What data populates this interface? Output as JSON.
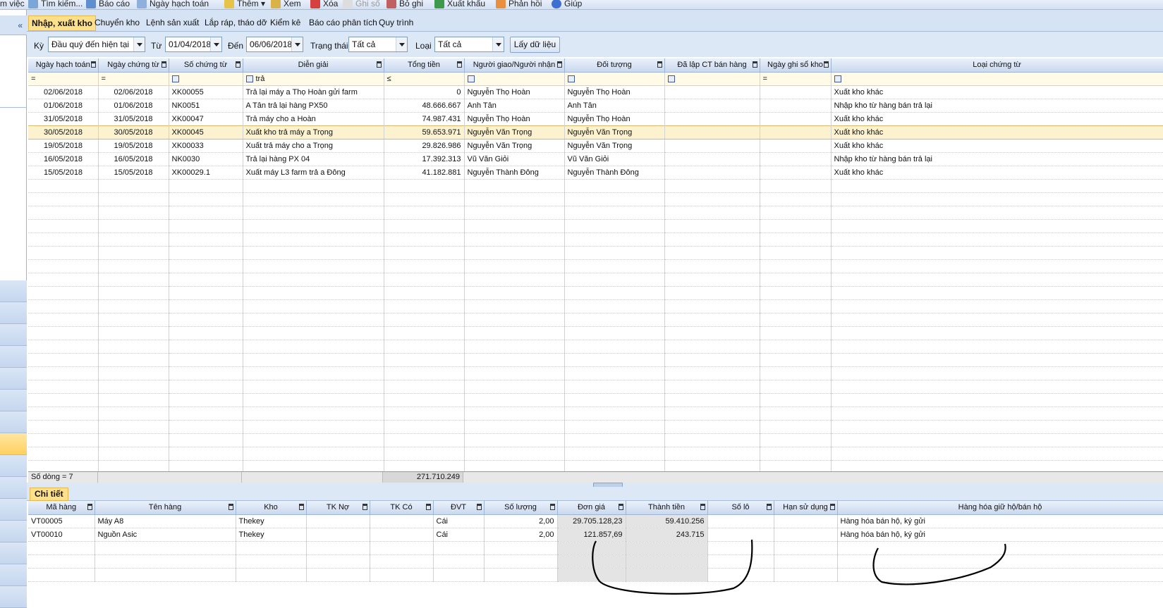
{
  "toolbar": {
    "items": [
      "m việc",
      "Tìm kiếm...",
      "Báo cáo",
      "Ngày hạch toán",
      "Thêm",
      "Xem",
      "Xóa",
      "Ghi sổ",
      "Bỏ ghi",
      "Xuất khẩu",
      "Phản hồi",
      "Giúp"
    ]
  },
  "sidebar": {
    "collapse_symbol": "«"
  },
  "tabs": [
    "Nhập, xuất kho",
    "Chuyển kho",
    "Lệnh sản xuất",
    "Lắp ráp, tháo dỡ",
    "Kiểm kê",
    "Báo cáo phân tích",
    "Quy trình"
  ],
  "filter": {
    "ky_label": "Kỳ",
    "ky_value": "Đầu quý đến hiện tại",
    "tu_label": "Từ",
    "tu_value": "01/04/2018",
    "den_label": "Đến",
    "den_value": "06/06/2018",
    "trangthai_label": "Trạng thái",
    "trangthai_value": "Tất cả",
    "loai_label": "Loại",
    "loai_value": "Tất cả",
    "fetch_button": "Lấy dữ liệu"
  },
  "main_grid": {
    "columns": [
      "Ngày hạch toán",
      "Ngày chứng từ",
      "Số chứng từ",
      "Diễn giải",
      "Tổng tiền",
      "Người giao/Người nhận",
      "Đối tượng",
      "Đã lập CT bán hàng",
      "Ngày ghi sổ kho",
      "Loại chứng từ"
    ],
    "filter_row": [
      "=",
      "=",
      "",
      "trả",
      "≤",
      "",
      "",
      "",
      "=",
      ""
    ],
    "rows": [
      [
        "02/06/2018",
        "02/06/2018",
        "XK00055",
        "Trả lại máy a Thọ Hoàn gửi farm",
        "0",
        "Nguyễn Thọ Hoàn",
        "Nguyễn Thọ Hoàn",
        "",
        "",
        "Xuất kho khác"
      ],
      [
        "01/06/2018",
        "01/06/2018",
        "NK0051",
        "A Tân trả lại hàng PX50",
        "48.666.667",
        "Anh Tân",
        "Anh Tân",
        "",
        "",
        "Nhập kho từ hàng bán trả lại"
      ],
      [
        "31/05/2018",
        "31/05/2018",
        "XK00047",
        "Trả máy cho a Hoàn",
        "74.987.431",
        "Nguyễn Thọ Hoàn",
        "Nguyễn Thọ Hoàn",
        "",
        "",
        "Xuất kho khác"
      ],
      [
        "30/05/2018",
        "30/05/2018",
        "XK00045",
        "Xuất kho trả máy a Trọng",
        "59.653.971",
        "Nguyễn Văn Trọng",
        "Nguyễn Văn Trọng",
        "",
        "",
        "Xuất kho khác"
      ],
      [
        "19/05/2018",
        "19/05/2018",
        "XK00033",
        "Xuất trả máy cho a Trọng",
        "29.826.986",
        "Nguyễn Văn Trọng",
        "Nguyễn Văn Trọng",
        "",
        "",
        "Xuất kho khác"
      ],
      [
        "16/05/2018",
        "16/05/2018",
        "NK0030",
        "Trả lại hàng PX 04",
        "17.392.313",
        "Vũ Văn Giỏi",
        "Vũ Văn Giỏi",
        "",
        "",
        "Nhập kho từ hàng bán trả lại"
      ],
      [
        "15/05/2018",
        "15/05/2018",
        "XK00029.1",
        "Xuất máy L3 farm trả a Đông",
        "41.182.881",
        "Nguyễn Thành Đông",
        "Nguyễn Thành Đông",
        "",
        "",
        "Xuất kho khác"
      ]
    ],
    "selected_row": 3,
    "footer_count": "Số dòng = 7",
    "footer_total": "271.710.249"
  },
  "detail": {
    "tab_label": "Chi tiết",
    "columns": [
      "Mã hàng",
      "Tên hàng",
      "Kho",
      "TK Nợ",
      "TK Có",
      "ĐVT",
      "Số lượng",
      "Đơn giá",
      "Thành tiền",
      "Số lô",
      "Hạn sử dụng",
      "Hàng hóa giữ hộ/bán hộ"
    ],
    "rows": [
      [
        "VT00005",
        "Máy A8",
        "Thekey",
        "",
        "",
        "Cái",
        "2,00",
        "29.705.128,23",
        "59.410.256",
        "",
        "",
        "Hàng hóa bán hộ, ký gửi"
      ],
      [
        "VT00010",
        "Nguồn Asic",
        "Thekey",
        "",
        "",
        "Cái",
        "2,00",
        "121.857,69",
        "243.715",
        "",
        "",
        "Hàng hóa bán hộ, ký gửi"
      ]
    ]
  },
  "colors": {
    "accent_tab": "#ffe08a",
    "header_bg": "#c9d9ef",
    "selected_row": "#fdf2cf"
  }
}
